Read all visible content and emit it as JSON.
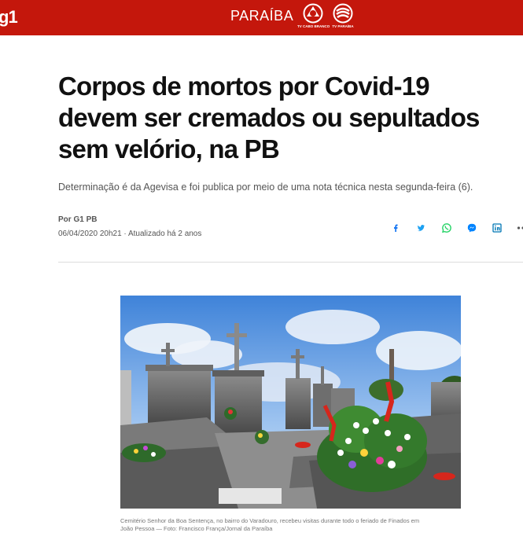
{
  "header": {
    "logo_text": "g1",
    "region": "PARAÍBA",
    "tv_logos": [
      {
        "name": "tv-cabo-branco-logo",
        "label": "TV CABO BRANCO"
      },
      {
        "name": "tv-paraiba-logo",
        "label": "TV PARAÍBA"
      }
    ],
    "background_color": "#c4170c"
  },
  "article": {
    "title_lines": [
      "Corpos de mortos por Covid-19",
      "devem ser cremados ou sepultados",
      "sem velório, na PB"
    ],
    "subtitle": "Determinação é da Agevisa e foi publica por meio de uma nota técnica nesta segunda-feira (6).",
    "author": "Por G1 PB",
    "date": "06/04/2020 20h21 · Atualizado há 2 anos",
    "share_icons": [
      {
        "name": "facebook-icon",
        "color": "#1877f2"
      },
      {
        "name": "twitter-icon",
        "color": "#1da1f2"
      },
      {
        "name": "whatsapp-icon",
        "color": "#25d366"
      },
      {
        "name": "messenger-icon",
        "color": "#0084ff"
      },
      {
        "name": "linkedin-icon",
        "color": "#0077b5"
      },
      {
        "name": "share-more-icon",
        "color": "#555555"
      }
    ],
    "photo": {
      "caption_line1": "Cemitério Senhor da Boa Sentença, no bairro do Varadouro, recebeu visitas durante todo o feriado de Finados em",
      "caption_line2": "João Pessoa — Foto: Francisco França/Jornal da Paraíba"
    }
  }
}
